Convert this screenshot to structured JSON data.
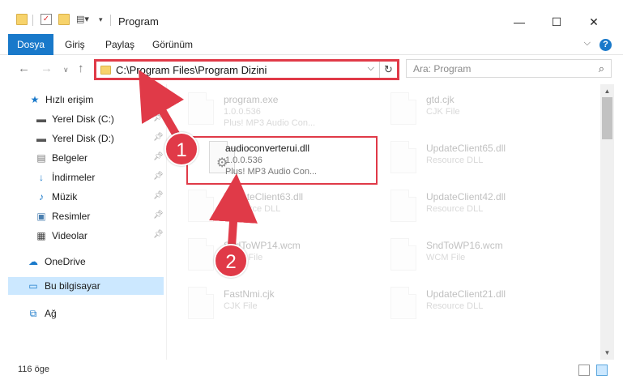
{
  "window": {
    "title": "Program",
    "controls": {
      "minimize": "—",
      "maximize": "☐",
      "close": "✕"
    }
  },
  "ribbon": {
    "tabs": [
      "Dosya",
      "Giriş",
      "Paylaş",
      "Görünüm"
    ],
    "help": "?"
  },
  "address": {
    "path": "C:\\Program Files\\Program Dizini",
    "search_placeholder": "Ara: Program"
  },
  "sidebar": {
    "items": [
      {
        "label": "Hızlı erişim",
        "icon": "star-icon",
        "pinned": false
      },
      {
        "label": "Yerel Disk (C:)",
        "icon": "drive-icon",
        "pinned": true
      },
      {
        "label": "Yerel Disk (D:)",
        "icon": "drive-icon",
        "pinned": true
      },
      {
        "label": "Belgeler",
        "icon": "documents-icon",
        "pinned": true
      },
      {
        "label": "İndirmeler",
        "icon": "download-icon",
        "pinned": true
      },
      {
        "label": "Müzik",
        "icon": "music-icon",
        "pinned": true
      },
      {
        "label": "Resimler",
        "icon": "pictures-icon",
        "pinned": true
      },
      {
        "label": "Videolar",
        "icon": "video-icon",
        "pinned": true
      },
      {
        "label": "OneDrive",
        "icon": "cloud-icon",
        "pinned": false
      },
      {
        "label": "Bu bilgisayar",
        "icon": "computer-icon",
        "pinned": false,
        "selected": true
      },
      {
        "label": "Ağ",
        "icon": "network-icon",
        "pinned": false
      }
    ]
  },
  "files": {
    "left": [
      {
        "name": "program.exe",
        "line1": "1.0.0.536",
        "line2": "Plus! MP3 Audio Con..."
      },
      {
        "name": "audioconverterui.dll",
        "line1": "1.0.0.536",
        "line2": "Plus! MP3 Audio Con...",
        "highlighted": true
      },
      {
        "name": "UpdateClient63.dll",
        "line1": "Resource DLL",
        "line2": ""
      },
      {
        "name": "SndToWP14.wcm",
        "line1": "WCM File",
        "line2": ""
      },
      {
        "name": "FastNmi.cjk",
        "line1": "CJK File",
        "line2": ""
      }
    ],
    "right": [
      {
        "name": "gtd.cjk",
        "line1": "CJK File",
        "line2": ""
      },
      {
        "name": "UpdateClient65.dll",
        "line1": "Resource DLL",
        "line2": ""
      },
      {
        "name": "UpdateClient42.dll",
        "line1": "Resource DLL",
        "line2": ""
      },
      {
        "name": "SndToWP16.wcm",
        "line1": "WCM File",
        "line2": ""
      },
      {
        "name": "UpdateClient21.dll",
        "line1": "Resource DLL",
        "line2": ""
      }
    ]
  },
  "status": {
    "count": "116 öge"
  },
  "callouts": [
    "1",
    "2"
  ],
  "colors": {
    "accent": "#1979ca",
    "highlight": "#e03a48",
    "selected": "#cce8ff"
  }
}
